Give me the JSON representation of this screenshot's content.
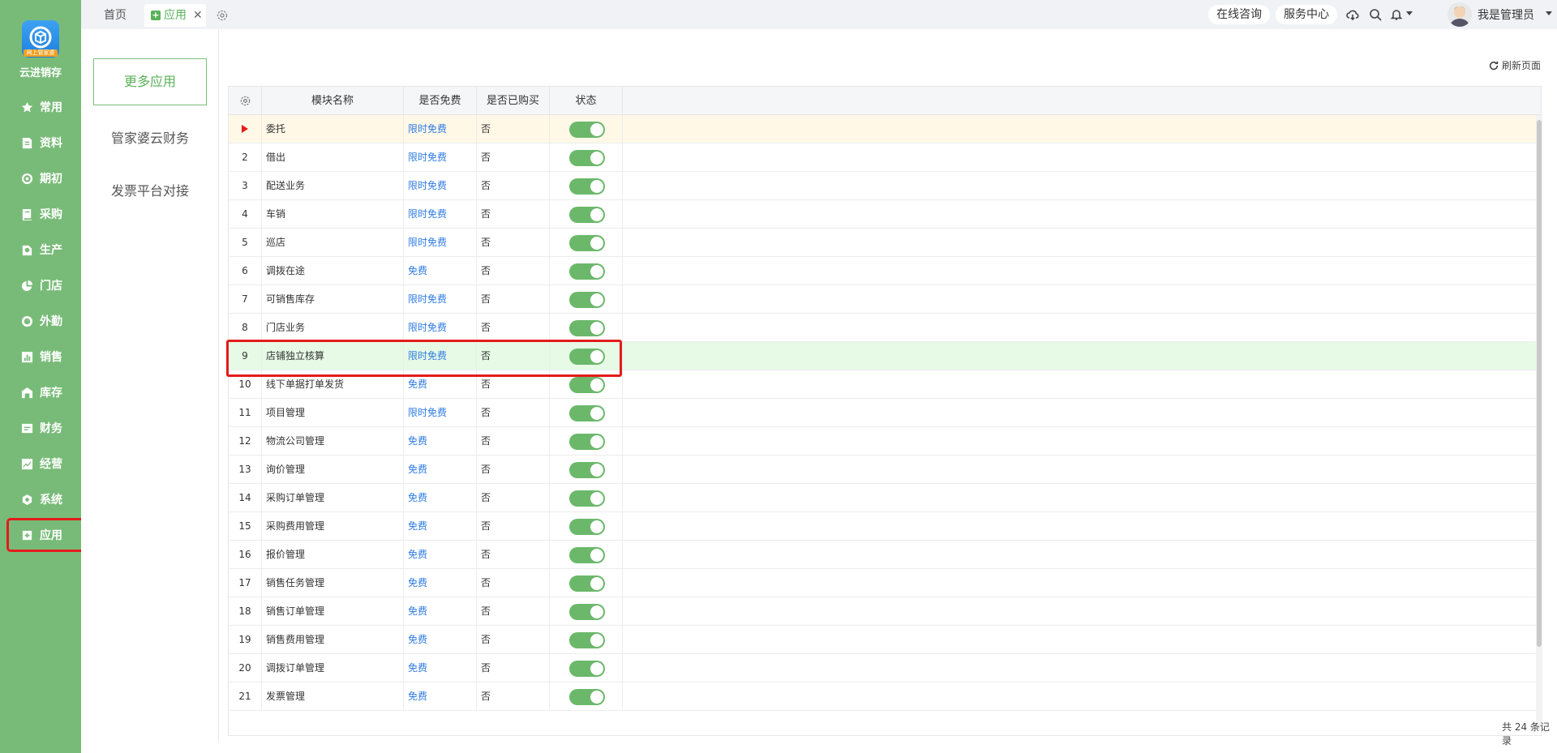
{
  "sidebar": {
    "logo_badge": "网上管家婆",
    "brand": "云进销存",
    "items": [
      {
        "label": "常用",
        "icon": "star-icon"
      },
      {
        "label": "资料",
        "icon": "document-icon"
      },
      {
        "label": "期初",
        "icon": "target-icon"
      },
      {
        "label": "采购",
        "icon": "book-icon"
      },
      {
        "label": "生产",
        "icon": "factory-icon"
      },
      {
        "label": "门店",
        "icon": "pie-icon"
      },
      {
        "label": "外勤",
        "icon": "compass-icon"
      },
      {
        "label": "销售",
        "icon": "chart-icon"
      },
      {
        "label": "库存",
        "icon": "warehouse-icon"
      },
      {
        "label": "财务",
        "icon": "wallet-icon"
      },
      {
        "label": "经营",
        "icon": "trend-icon"
      },
      {
        "label": "系统",
        "icon": "gear-icon"
      },
      {
        "label": "应用",
        "icon": "plus-square-icon"
      }
    ]
  },
  "topbar": {
    "tab_home": "首页",
    "tab_app": "应用",
    "online_consult": "在线咨询",
    "service_center": "服务中心",
    "username": "我是管理员"
  },
  "submenu": {
    "more_apps": "更多应用",
    "items": [
      "管家婆云财务",
      "发票平台对接"
    ]
  },
  "toolbar": {
    "refresh": "刷新页面"
  },
  "table": {
    "columns": [
      "模块名称",
      "是否免费",
      "是否已购买",
      "状态"
    ],
    "rows": [
      {
        "idx": "",
        "name": "委托",
        "free": "限时免费",
        "bought": "否"
      },
      {
        "idx": "2",
        "name": "借出",
        "free": "限时免费",
        "bought": "否"
      },
      {
        "idx": "3",
        "name": "配送业务",
        "free": "限时免费",
        "bought": "否"
      },
      {
        "idx": "4",
        "name": "车销",
        "free": "限时免费",
        "bought": "否"
      },
      {
        "idx": "5",
        "name": "巡店",
        "free": "限时免费",
        "bought": "否"
      },
      {
        "idx": "6",
        "name": "调拨在途",
        "free": "免费",
        "bought": "否"
      },
      {
        "idx": "7",
        "name": "可销售库存",
        "free": "限时免费",
        "bought": "否"
      },
      {
        "idx": "8",
        "name": "门店业务",
        "free": "限时免费",
        "bought": "否"
      },
      {
        "idx": "9",
        "name": "店铺独立核算",
        "free": "限时免费",
        "bought": "否"
      },
      {
        "idx": "10",
        "name": "线下单据打单发货",
        "free": "免费",
        "bought": "否"
      },
      {
        "idx": "11",
        "name": "项目管理",
        "free": "限时免费",
        "bought": "否"
      },
      {
        "idx": "12",
        "name": "物流公司管理",
        "free": "免费",
        "bought": "否"
      },
      {
        "idx": "13",
        "name": "询价管理",
        "free": "免费",
        "bought": "否"
      },
      {
        "idx": "14",
        "name": "采购订单管理",
        "free": "免费",
        "bought": "否"
      },
      {
        "idx": "15",
        "name": "采购费用管理",
        "free": "免费",
        "bought": "否"
      },
      {
        "idx": "16",
        "name": "报价管理",
        "free": "免费",
        "bought": "否"
      },
      {
        "idx": "17",
        "name": "销售任务管理",
        "free": "免费",
        "bought": "否"
      },
      {
        "idx": "18",
        "name": "销售订单管理",
        "free": "免费",
        "bought": "否"
      },
      {
        "idx": "19",
        "name": "销售费用管理",
        "free": "免费",
        "bought": "否"
      },
      {
        "idx": "20",
        "name": "调拨订单管理",
        "free": "免费",
        "bought": "否"
      },
      {
        "idx": "21",
        "name": "发票管理",
        "free": "免费",
        "bought": "否"
      }
    ],
    "total": "共 24 条记录"
  },
  "colors": {
    "sidebar": "#78bb78",
    "accent": "#59b259",
    "link": "#2e7be3",
    "highlight": "#e31c1c"
  }
}
